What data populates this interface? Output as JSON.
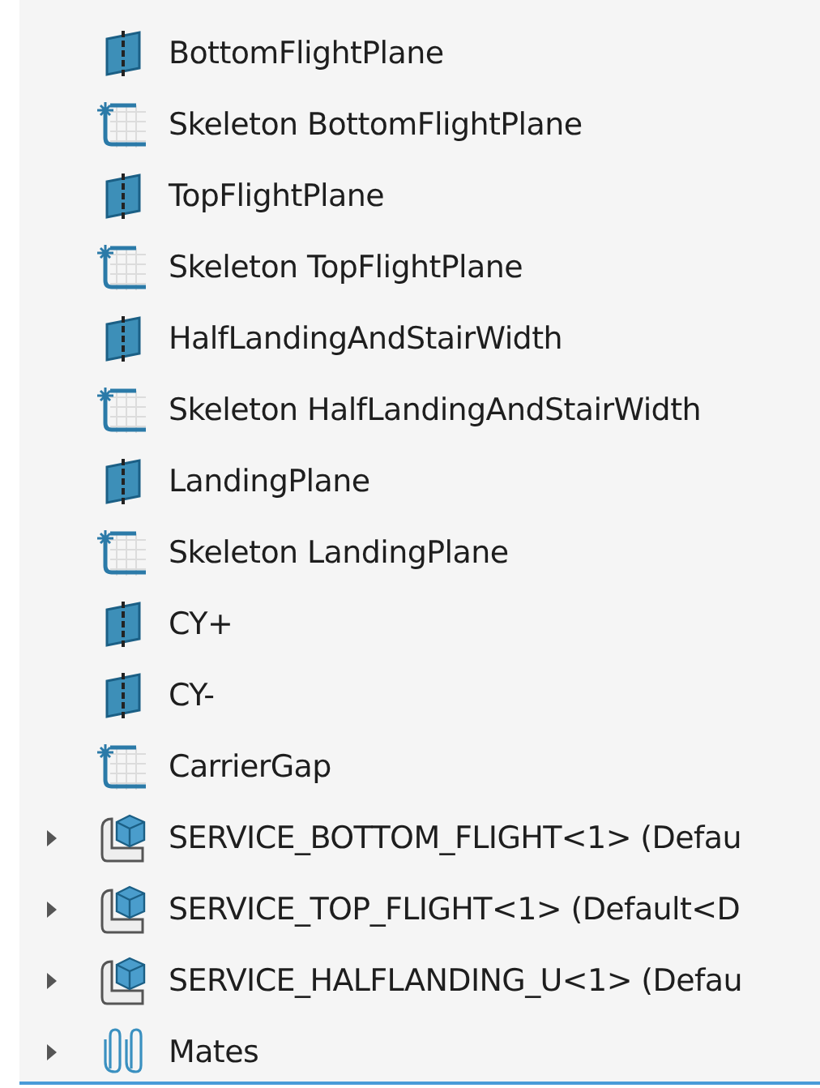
{
  "tree": {
    "items": [
      {
        "kind": "plane",
        "label": "BottomFlightPlane"
      },
      {
        "kind": "sketch",
        "label": "Skeleton BottomFlightPlane"
      },
      {
        "kind": "plane",
        "label": "TopFlightPlane"
      },
      {
        "kind": "sketch",
        "label": "Skeleton TopFlightPlane"
      },
      {
        "kind": "plane",
        "label": "HalfLandingAndStairWidth"
      },
      {
        "kind": "sketch",
        "label": "Skeleton HalfLandingAndStairWidth"
      },
      {
        "kind": "plane",
        "label": "LandingPlane"
      },
      {
        "kind": "sketch",
        "label": "Skeleton LandingPlane"
      },
      {
        "kind": "plane",
        "label": "CY+"
      },
      {
        "kind": "plane",
        "label": "CY-"
      },
      {
        "kind": "sketch",
        "label": "CarrierGap"
      },
      {
        "kind": "part",
        "label": "SERVICE_BOTTOM_FLIGHT<1> (Defau",
        "expanded": false
      },
      {
        "kind": "part",
        "label": "SERVICE_TOP_FLIGHT<1> (Default<D",
        "expanded": false
      },
      {
        "kind": "part",
        "label": "SERVICE_HALFLANDING_U<1> (Defau",
        "expanded": false
      },
      {
        "kind": "mates",
        "label": "Mates",
        "expanded": false
      }
    ]
  }
}
